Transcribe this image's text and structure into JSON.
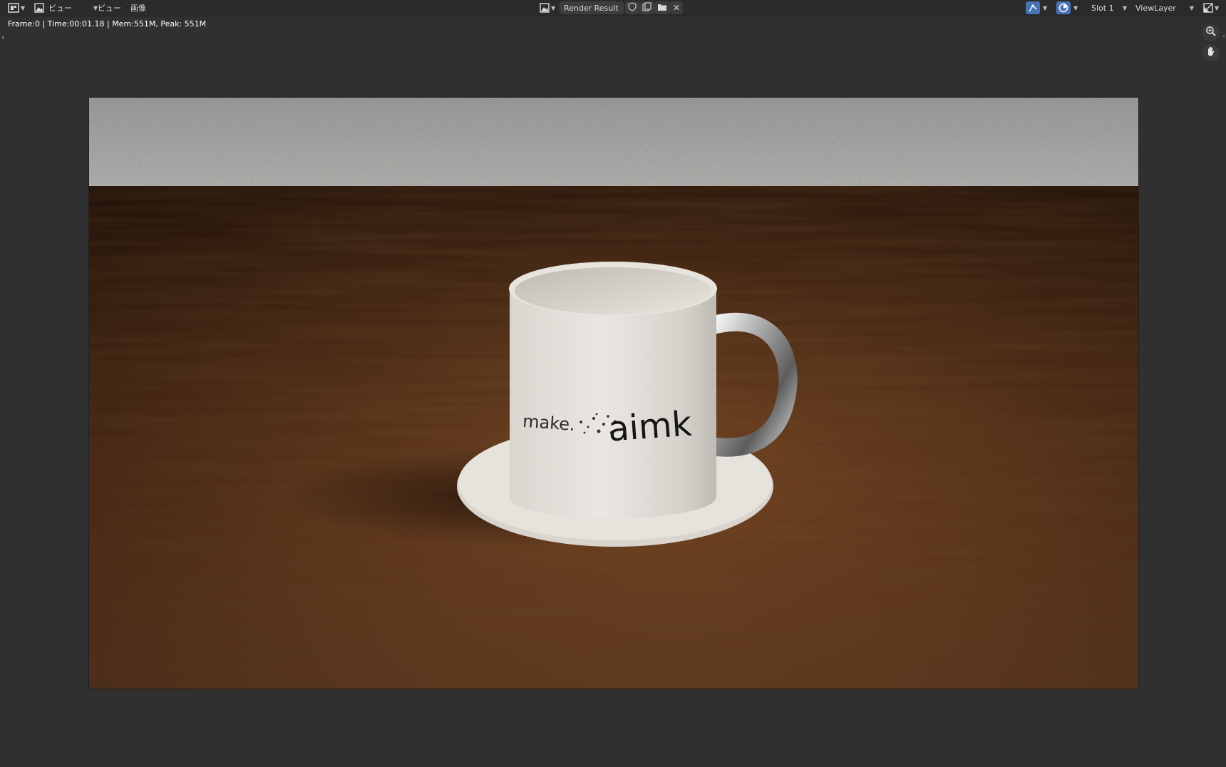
{
  "header": {
    "editor_type_icon": "image-editor-icon",
    "view_menu_label": "ビュー",
    "view_menu2_label": "ビュー",
    "image_menu_label": "画像",
    "image_name": "Render Result",
    "slot_label": "Slot 1",
    "view_layer_label": "ViewLayer"
  },
  "status": {
    "text": "Frame:0 | Time:00:01.18 | Mem:551M, Peak: 551M"
  },
  "render": {
    "mug_text_left": "make.",
    "mug_text_right": "aimk"
  },
  "colors": {
    "bg": "#303030",
    "header": "#2b2b2b",
    "accent": "#4772b3"
  }
}
